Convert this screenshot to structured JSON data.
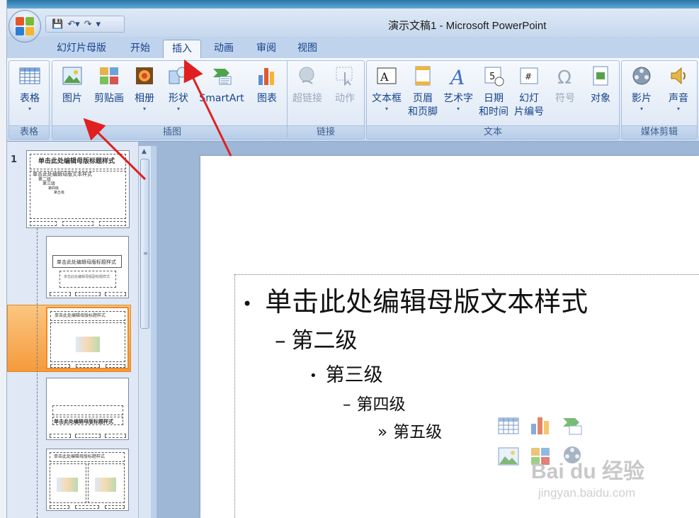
{
  "window": {
    "title": "演示文稿1 - Microsoft PowerPoint"
  },
  "qat": {
    "icons": [
      "save-icon",
      "undo-icon",
      "redo-icon",
      "customize-icon"
    ]
  },
  "tabs": [
    {
      "label": "幻灯片母版"
    },
    {
      "label": "开始"
    },
    {
      "label": "插入",
      "active": true
    },
    {
      "label": "动画"
    },
    {
      "label": "审阅"
    },
    {
      "label": "视图"
    }
  ],
  "ribbon": {
    "groups": [
      {
        "label": "表格",
        "buttons": [
          {
            "label": "表格",
            "icon": "table-icon",
            "dropdown": true
          }
        ]
      },
      {
        "label": "插图",
        "buttons": [
          {
            "label": "图片",
            "icon": "picture-icon"
          },
          {
            "label": "剪贴画",
            "icon": "clipart-icon"
          },
          {
            "label": "相册",
            "icon": "photo-album-icon",
            "dropdown": true
          },
          {
            "label": "形状",
            "icon": "shapes-icon",
            "dropdown": true
          },
          {
            "label": "SmartArt",
            "icon": "smartart-icon"
          },
          {
            "label": "图表",
            "icon": "chart-icon"
          }
        ]
      },
      {
        "label": "链接",
        "buttons": [
          {
            "label": "超链接",
            "icon": "hyperlink-icon",
            "disabled": true
          },
          {
            "label": "动作",
            "icon": "action-icon",
            "disabled": true
          }
        ]
      },
      {
        "label": "文本",
        "buttons": [
          {
            "label": "文本框",
            "icon": "textbox-icon",
            "dropdown": true
          },
          {
            "label": "页眉",
            "label2": "和页脚",
            "icon": "header-footer-icon"
          },
          {
            "label": "艺术字",
            "icon": "wordart-icon",
            "dropdown": true
          },
          {
            "label": "日期",
            "label2": "和时间",
            "icon": "date-time-icon"
          },
          {
            "label": "幻灯",
            "label2": "片编号",
            "icon": "slide-number-icon"
          },
          {
            "label": "符号",
            "icon": "symbol-icon",
            "disabled": true
          },
          {
            "label": "对象",
            "icon": "object-icon"
          }
        ]
      },
      {
        "label": "媒体剪辑",
        "buttons": [
          {
            "label": "影片",
            "icon": "movie-icon",
            "dropdown": true
          },
          {
            "label": "声音",
            "icon": "sound-icon",
            "dropdown": true
          }
        ]
      }
    ]
  },
  "thumbnails": {
    "number": "1",
    "master_title": "单击此处编辑母版标题样式",
    "master_body": "单击此处编辑母版文本样式",
    "master_l2": "第二级",
    "master_l3": "第三级",
    "master_l4": "第四级",
    "master_l5": "第五级",
    "title_layout_title": "单击此处编辑母版标题样式",
    "title_layout_sub": "单击此处编辑母版副标题样式",
    "content_layout_title": "单击此处编辑母版标题样式",
    "section_title": "单击此处编辑母版标题样式",
    "two_content_title": "单击此处编辑母版标题样式"
  },
  "slide": {
    "level1": "单击此处编辑母版文本样式",
    "level2": "第二级",
    "level3": "第三级",
    "level4": "第四级",
    "level5": "第五级",
    "bullet1": "•",
    "bullet2": "–",
    "bullet3": "•",
    "bullet4": "–",
    "bullet5": "»"
  },
  "watermark": {
    "brand": "Bai du 经验",
    "url": "jingyan.baidu.com"
  },
  "colors": {
    "ribbon_text": "#15428b",
    "selection": "#f59a3c",
    "annotation_arrow": "#e02020"
  }
}
